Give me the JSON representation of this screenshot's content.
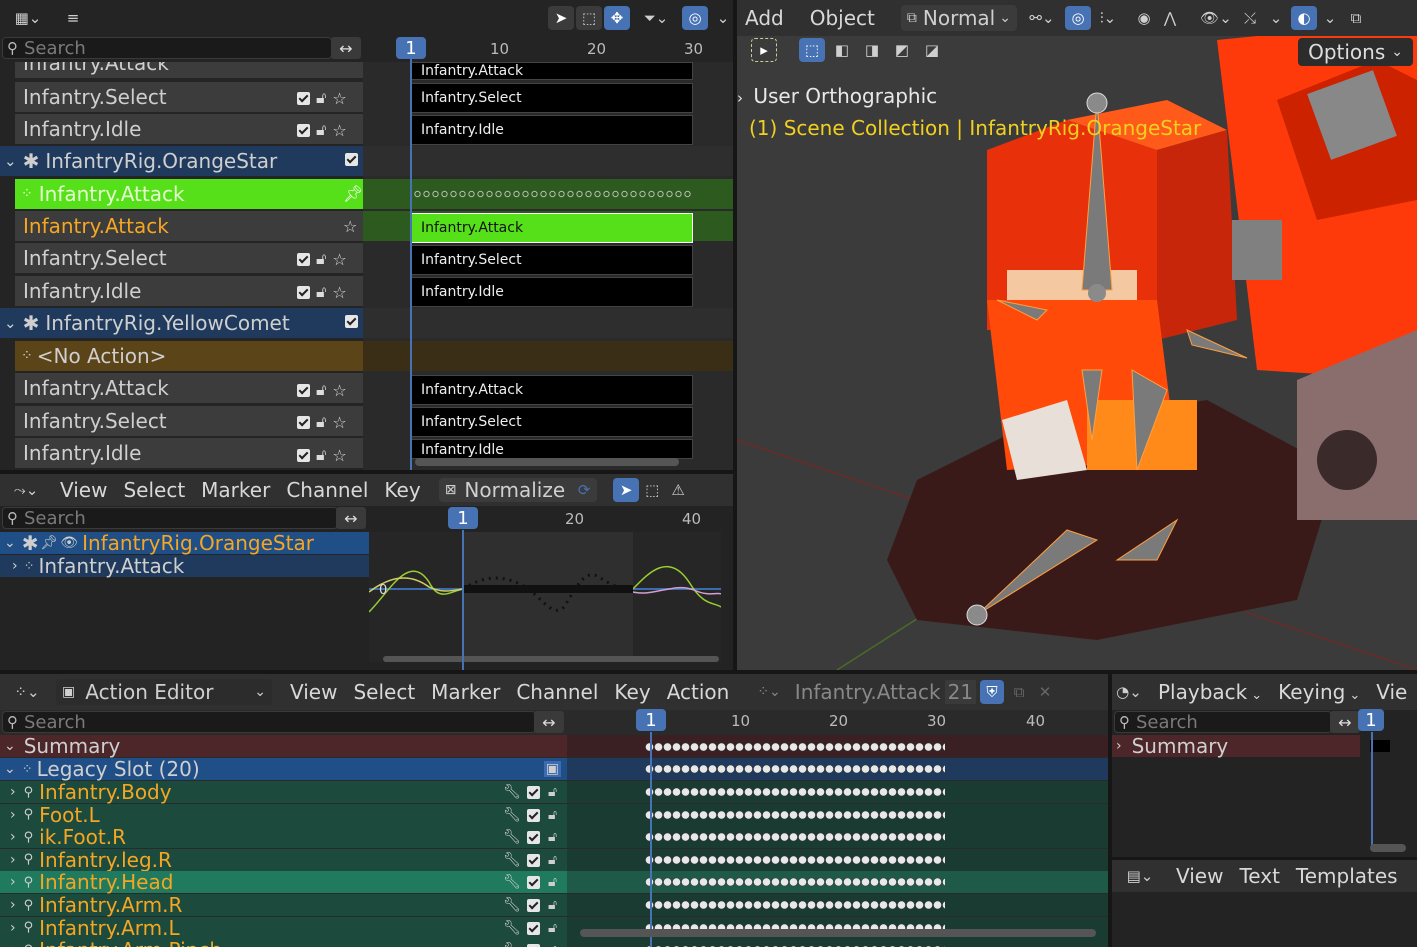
{
  "nla": {
    "search_placeholder": "Search",
    "ticks": [
      "1",
      "10",
      "20",
      "30"
    ],
    "current_frame": "1",
    "rows": [
      {
        "label": "Infantry.Attack",
        "strip": "Infantry.Attack"
      },
      {
        "label": "Infantry.Select",
        "strip": "Infantry.Select"
      },
      {
        "label": "Infantry.Idle",
        "strip": "Infantry.Idle"
      },
      {
        "label": "InfantryRig.OrangeStar"
      },
      {
        "label": "Infantry.Attack"
      },
      {
        "label": "Infantry.Attack",
        "strip": "Infantry.Attack"
      },
      {
        "label": "Infantry.Select",
        "strip": "Infantry.Select"
      },
      {
        "label": "Infantry.Idle",
        "strip": "Infantry.Idle"
      },
      {
        "label": "InfantryRig.YellowComet"
      },
      {
        "label": "<No Action>"
      },
      {
        "label": "Infantry.Attack",
        "strip": "Infantry.Attack"
      },
      {
        "label": "Infantry.Select",
        "strip": "Infantry.Select"
      },
      {
        "label": "Infantry.Idle",
        "strip": "Infantry.Idle"
      }
    ]
  },
  "graph": {
    "menu": [
      "View",
      "Select",
      "Marker",
      "Channel",
      "Key"
    ],
    "normalize": "Normalize",
    "search_placeholder": "Search",
    "ticks": [
      "1",
      "20",
      "40"
    ],
    "current_frame": "1",
    "zero_label": "0",
    "channels": [
      "InfantryRig.OrangeStar",
      "Infantry.Attack"
    ]
  },
  "viewport": {
    "menu": [
      "Add",
      "Object"
    ],
    "mode": "Normal",
    "options": "Options",
    "view_name": "User Orthographic",
    "collection": "(1) Scene Collection | InfantryRig.OrangeStar"
  },
  "action_editor": {
    "mode": "Action Editor",
    "menu": [
      "View",
      "Select",
      "Marker",
      "Channel",
      "Key",
      "Action"
    ],
    "action_name": "Infantry.Attack",
    "users": "21",
    "search_placeholder": "Search",
    "ticks": [
      "1",
      "10",
      "20",
      "30",
      "40"
    ],
    "current_frame": "1",
    "summary": "Summary",
    "slot": "Legacy Slot (20)",
    "channels": [
      "Infantry.Body",
      "Foot.L",
      "ik.Foot.R",
      "Infantry.leg.R",
      "Infantry.Head",
      "Infantry.Arm.R",
      "Infantry.Arm.L",
      "Infantry.Arm.Pinch"
    ]
  },
  "timeline": {
    "menu": [
      "Playback",
      "Keying",
      "Vie"
    ],
    "search_placeholder": "Search",
    "current_frame": "1",
    "summary": "Summary"
  },
  "text_editor": {
    "menu": [
      "View",
      "Text",
      "Templates"
    ]
  },
  "colors": {
    "accent": "#4772b3",
    "selected_green": "#56e01a",
    "orange_text": "#f5a623"
  }
}
